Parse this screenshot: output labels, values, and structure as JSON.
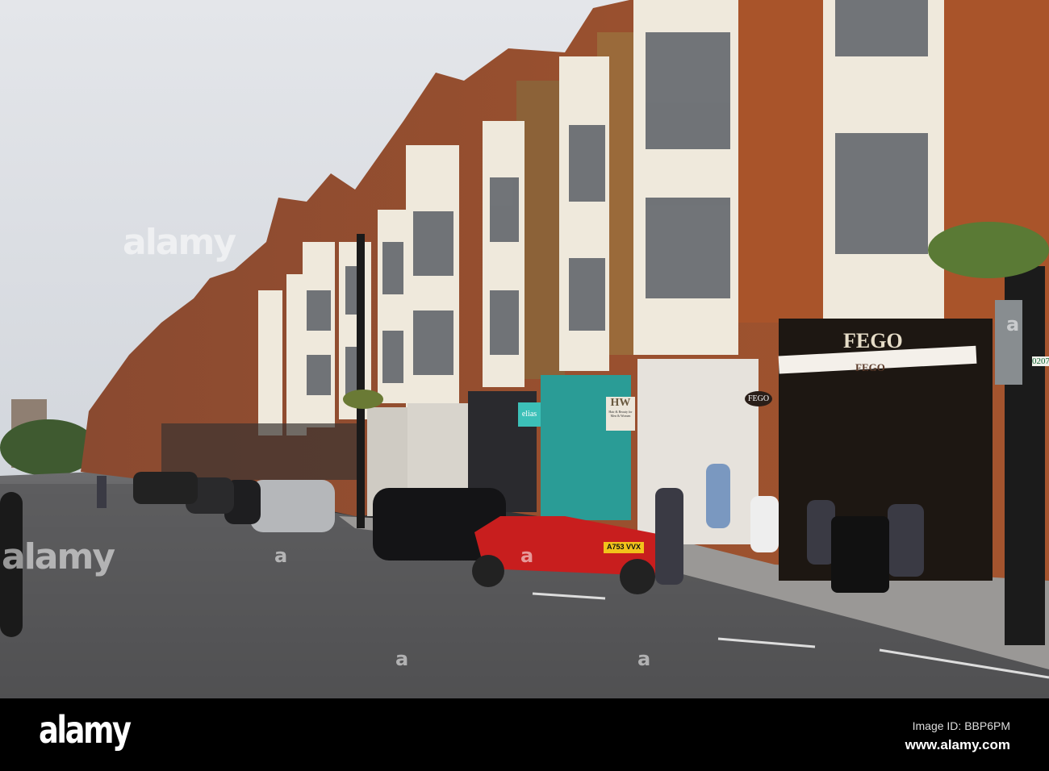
{
  "photo": {
    "watermarks": [
      "alamy",
      "alamy",
      "a",
      "a",
      "a",
      "a",
      "a"
    ],
    "signs": {
      "cafe_name": "FEGO",
      "cafe_awning": "FEGO",
      "cafe_hanging_sign": "FEGO",
      "salon_sign": "HW",
      "salon_sign_sub": "Hair & Beauty for Men & Women",
      "shop_sign": "elias",
      "phone_sign": "0207"
    },
    "car_plate": "A753 VVX"
  },
  "footer": {
    "logo": "alamy",
    "image_id": "Image ID: BBP6PM",
    "url": "www.alamy.com"
  }
}
